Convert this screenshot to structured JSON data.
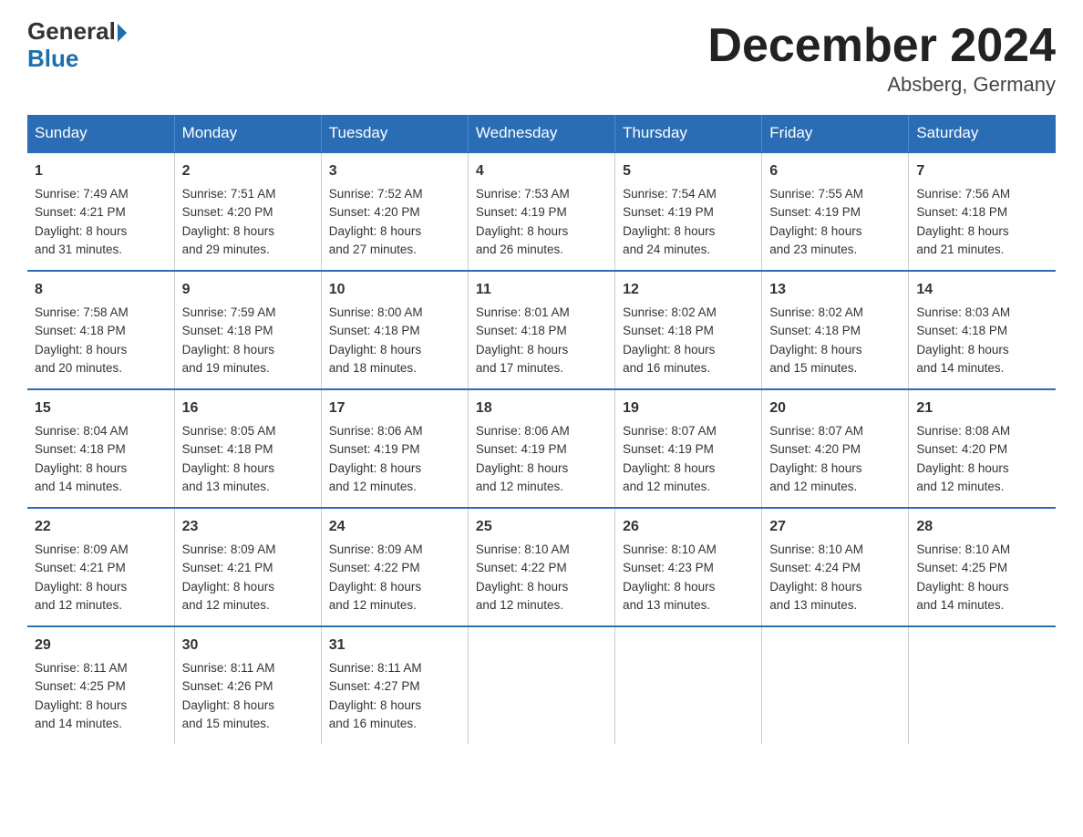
{
  "logo": {
    "general": "General",
    "blue": "Blue"
  },
  "header": {
    "title": "December 2024",
    "location": "Absberg, Germany"
  },
  "days_header": [
    "Sunday",
    "Monday",
    "Tuesday",
    "Wednesday",
    "Thursday",
    "Friday",
    "Saturday"
  ],
  "weeks": [
    [
      {
        "day": "1",
        "sunrise": "7:49 AM",
        "sunset": "4:21 PM",
        "daylight": "8 hours and 31 minutes."
      },
      {
        "day": "2",
        "sunrise": "7:51 AM",
        "sunset": "4:20 PM",
        "daylight": "8 hours and 29 minutes."
      },
      {
        "day": "3",
        "sunrise": "7:52 AM",
        "sunset": "4:20 PM",
        "daylight": "8 hours and 27 minutes."
      },
      {
        "day": "4",
        "sunrise": "7:53 AM",
        "sunset": "4:19 PM",
        "daylight": "8 hours and 26 minutes."
      },
      {
        "day": "5",
        "sunrise": "7:54 AM",
        "sunset": "4:19 PM",
        "daylight": "8 hours and 24 minutes."
      },
      {
        "day": "6",
        "sunrise": "7:55 AM",
        "sunset": "4:19 PM",
        "daylight": "8 hours and 23 minutes."
      },
      {
        "day": "7",
        "sunrise": "7:56 AM",
        "sunset": "4:18 PM",
        "daylight": "8 hours and 21 minutes."
      }
    ],
    [
      {
        "day": "8",
        "sunrise": "7:58 AM",
        "sunset": "4:18 PM",
        "daylight": "8 hours and 20 minutes."
      },
      {
        "day": "9",
        "sunrise": "7:59 AM",
        "sunset": "4:18 PM",
        "daylight": "8 hours and 19 minutes."
      },
      {
        "day": "10",
        "sunrise": "8:00 AM",
        "sunset": "4:18 PM",
        "daylight": "8 hours and 18 minutes."
      },
      {
        "day": "11",
        "sunrise": "8:01 AM",
        "sunset": "4:18 PM",
        "daylight": "8 hours and 17 minutes."
      },
      {
        "day": "12",
        "sunrise": "8:02 AM",
        "sunset": "4:18 PM",
        "daylight": "8 hours and 16 minutes."
      },
      {
        "day": "13",
        "sunrise": "8:02 AM",
        "sunset": "4:18 PM",
        "daylight": "8 hours and 15 minutes."
      },
      {
        "day": "14",
        "sunrise": "8:03 AM",
        "sunset": "4:18 PM",
        "daylight": "8 hours and 14 minutes."
      }
    ],
    [
      {
        "day": "15",
        "sunrise": "8:04 AM",
        "sunset": "4:18 PM",
        "daylight": "8 hours and 14 minutes."
      },
      {
        "day": "16",
        "sunrise": "8:05 AM",
        "sunset": "4:18 PM",
        "daylight": "8 hours and 13 minutes."
      },
      {
        "day": "17",
        "sunrise": "8:06 AM",
        "sunset": "4:19 PM",
        "daylight": "8 hours and 12 minutes."
      },
      {
        "day": "18",
        "sunrise": "8:06 AM",
        "sunset": "4:19 PM",
        "daylight": "8 hours and 12 minutes."
      },
      {
        "day": "19",
        "sunrise": "8:07 AM",
        "sunset": "4:19 PM",
        "daylight": "8 hours and 12 minutes."
      },
      {
        "day": "20",
        "sunrise": "8:07 AM",
        "sunset": "4:20 PM",
        "daylight": "8 hours and 12 minutes."
      },
      {
        "day": "21",
        "sunrise": "8:08 AM",
        "sunset": "4:20 PM",
        "daylight": "8 hours and 12 minutes."
      }
    ],
    [
      {
        "day": "22",
        "sunrise": "8:09 AM",
        "sunset": "4:21 PM",
        "daylight": "8 hours and 12 minutes."
      },
      {
        "day": "23",
        "sunrise": "8:09 AM",
        "sunset": "4:21 PM",
        "daylight": "8 hours and 12 minutes."
      },
      {
        "day": "24",
        "sunrise": "8:09 AM",
        "sunset": "4:22 PM",
        "daylight": "8 hours and 12 minutes."
      },
      {
        "day": "25",
        "sunrise": "8:10 AM",
        "sunset": "4:22 PM",
        "daylight": "8 hours and 12 minutes."
      },
      {
        "day": "26",
        "sunrise": "8:10 AM",
        "sunset": "4:23 PM",
        "daylight": "8 hours and 13 minutes."
      },
      {
        "day": "27",
        "sunrise": "8:10 AM",
        "sunset": "4:24 PM",
        "daylight": "8 hours and 13 minutes."
      },
      {
        "day": "28",
        "sunrise": "8:10 AM",
        "sunset": "4:25 PM",
        "daylight": "8 hours and 14 minutes."
      }
    ],
    [
      {
        "day": "29",
        "sunrise": "8:11 AM",
        "sunset": "4:25 PM",
        "daylight": "8 hours and 14 minutes."
      },
      {
        "day": "30",
        "sunrise": "8:11 AM",
        "sunset": "4:26 PM",
        "daylight": "8 hours and 15 minutes."
      },
      {
        "day": "31",
        "sunrise": "8:11 AM",
        "sunset": "4:27 PM",
        "daylight": "8 hours and 16 minutes."
      },
      null,
      null,
      null,
      null
    ]
  ],
  "labels": {
    "sunrise": "Sunrise:",
    "sunset": "Sunset:",
    "daylight": "Daylight:"
  }
}
